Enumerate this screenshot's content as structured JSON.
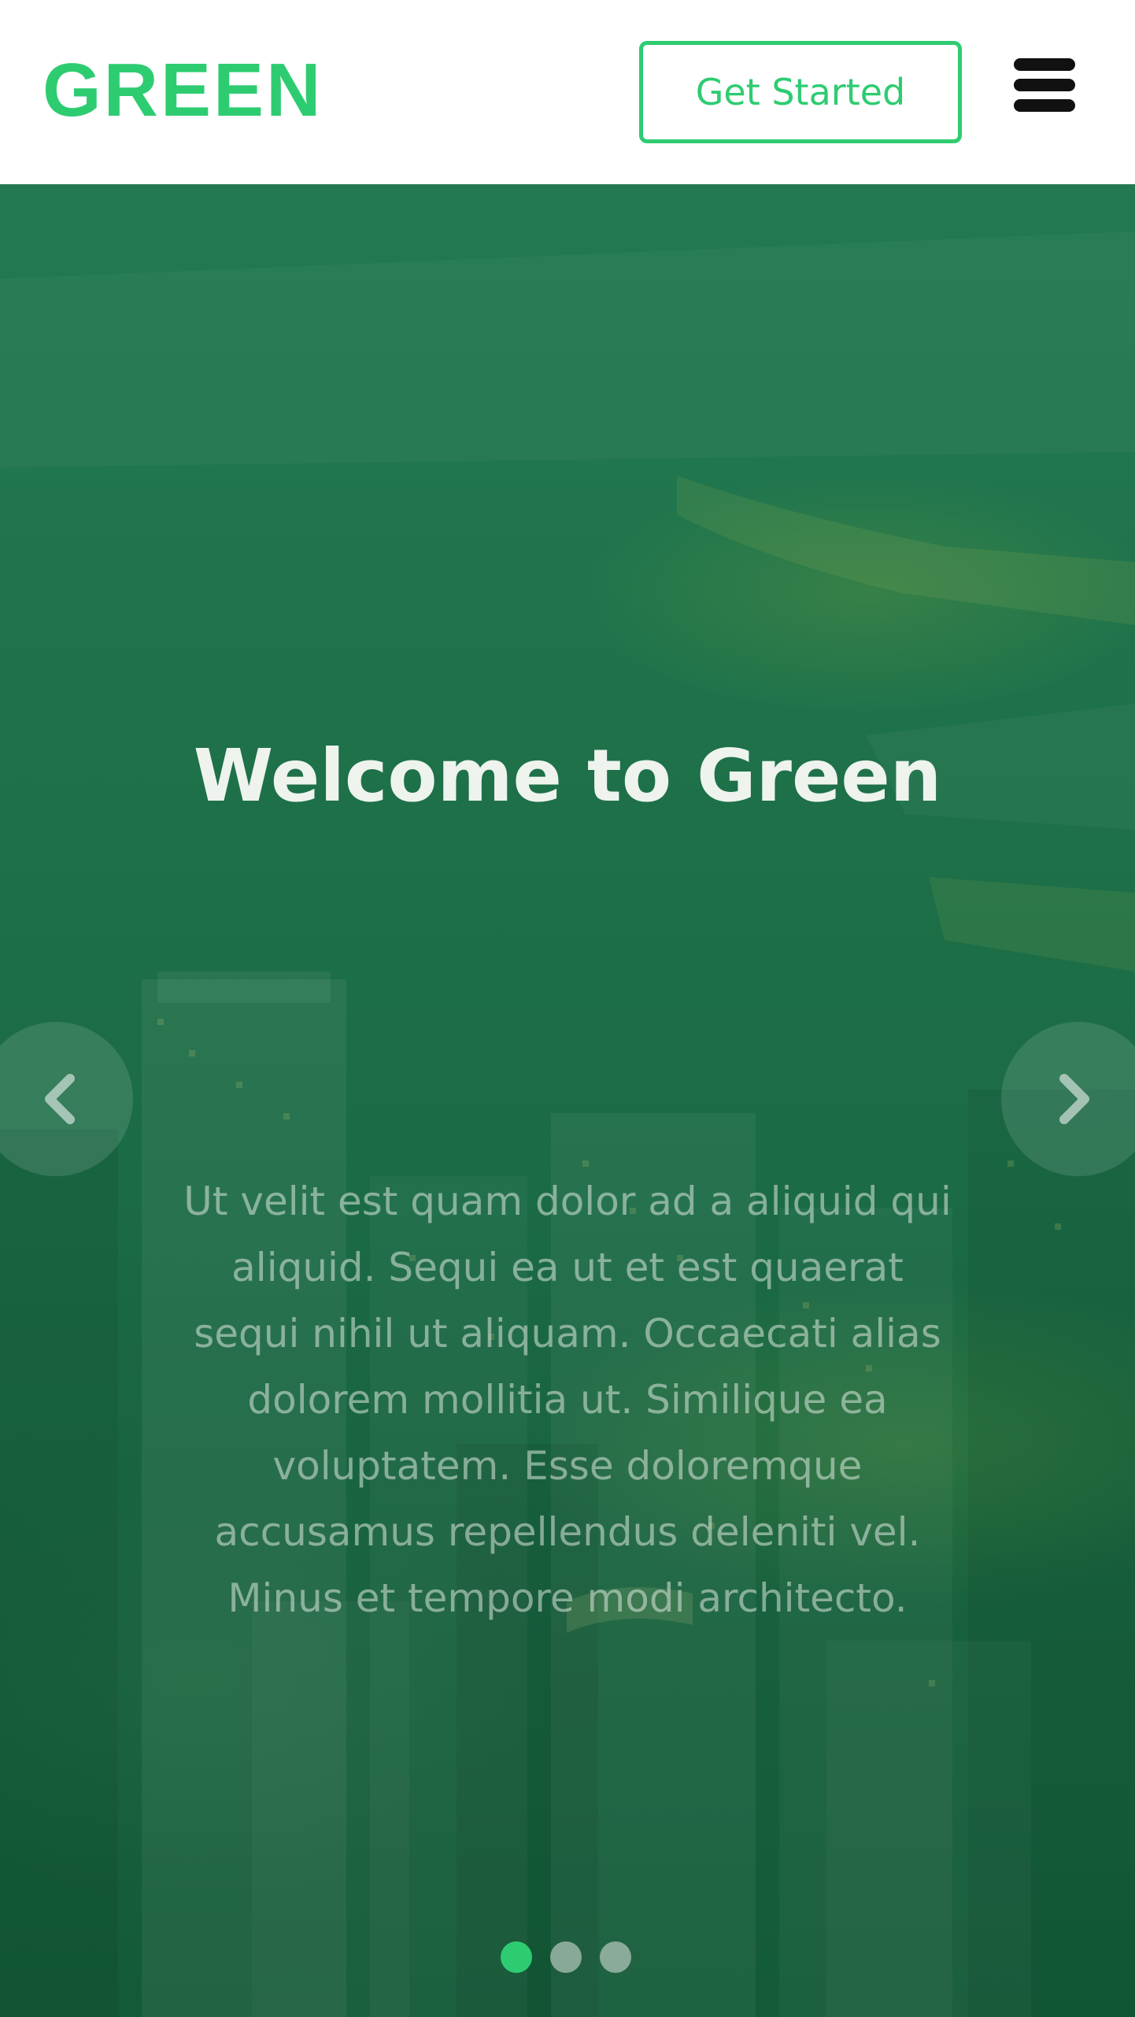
{
  "header": {
    "logo_text": "GREEN",
    "cta_label": "Get Started",
    "menu_icon": "hamburger-menu-icon"
  },
  "hero": {
    "title": "Welcome to Green",
    "body": "Ut velit est quam dolor ad a aliquid qui aliquid. Sequi ea ut et est quaerat sequi nihil ut aliquam. Occaecati alias dolorem mollitia ut. Similique ea voluptatem. Esse doloremque accusamus repellendus deleniti vel. Minus et tempore modi architecto.",
    "prev_icon": "chevron-left-icon",
    "next_icon": "chevron-right-icon",
    "slides_total": 3,
    "active_slide": 1
  },
  "colors": {
    "brand": "#2ecc71",
    "overlay": "#1b6b45",
    "menu_icon": "#111111"
  }
}
